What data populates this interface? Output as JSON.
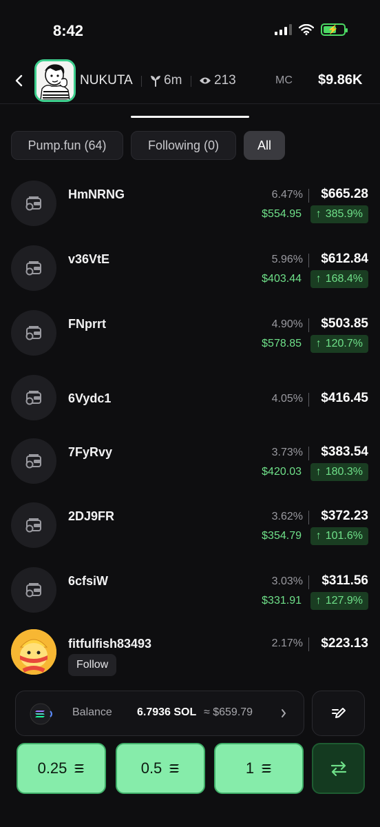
{
  "status_bar": {
    "time": "8:42"
  },
  "header": {
    "token_name": "NUKUTA",
    "age": "6m",
    "views": "213",
    "mc_label": "MC",
    "mc_value": "$9.86K"
  },
  "filters": [
    {
      "label": "Pump.fun (64)",
      "active": false
    },
    {
      "label": "Following (0)",
      "active": false
    },
    {
      "label": "All",
      "active": true
    }
  ],
  "holders": [
    {
      "name": "HmNRNG",
      "percent": "6.47%",
      "amount": "$665.28",
      "cost": "$554.95",
      "change": "385.9%"
    },
    {
      "name": "v36VtE",
      "percent": "5.96%",
      "amount": "$612.84",
      "cost": "$403.44",
      "change": "168.4%"
    },
    {
      "name": "FNprrt",
      "percent": "4.90%",
      "amount": "$503.85",
      "cost": "$578.85",
      "change": "120.7%"
    },
    {
      "name": "6Vydc1",
      "percent": "4.05%",
      "amount": "$416.45",
      "cost": "",
      "change": ""
    },
    {
      "name": "7FyRvy",
      "percent": "3.73%",
      "amount": "$383.54",
      "cost": "$420.03",
      "change": "180.3%"
    },
    {
      "name": "2DJ9FR",
      "percent": "3.62%",
      "amount": "$372.23",
      "cost": "$354.79",
      "change": "101.6%"
    },
    {
      "name": "6cfsiW",
      "percent": "3.03%",
      "amount": "$311.56",
      "cost": "$331.91",
      "change": "127.9%"
    },
    {
      "name": "fitfulfish83493",
      "percent": "2.17%",
      "amount": "$223.13",
      "follow_label": "Follow"
    }
  ],
  "bottom": {
    "balance_label": "Balance",
    "balance_sol": "6.7936 SOL",
    "balance_usd": "≈ $659.79",
    "amounts": [
      "0.25",
      "0.5",
      "1"
    ]
  },
  "colors": {
    "accent": "#86ecaa",
    "positive": "#6fe089",
    "ring": "#3ecf8e"
  }
}
